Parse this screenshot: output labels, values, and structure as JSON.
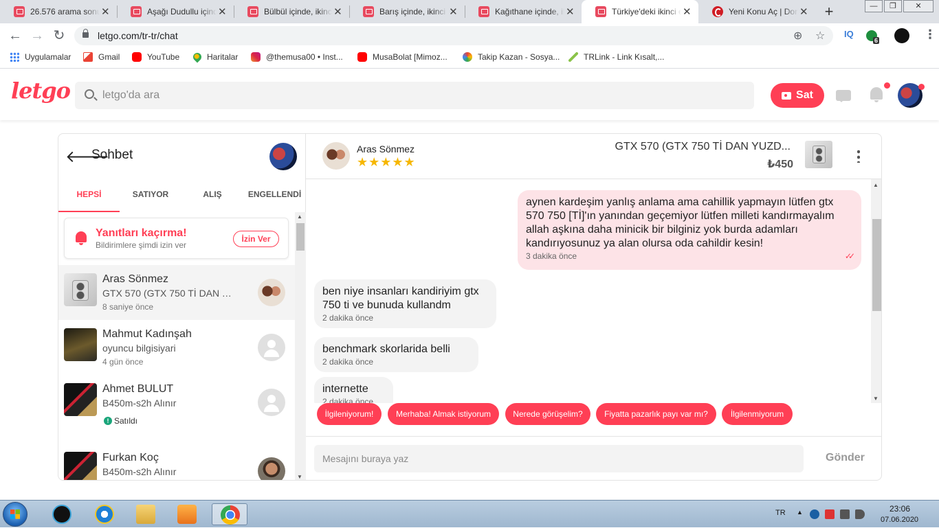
{
  "browser": {
    "tabs": [
      {
        "title": "26.576 arama sonuç",
        "active": false
      },
      {
        "title": "Aşağı Dudullu içind",
        "active": false
      },
      {
        "title": "Bülbül içinde, ikinci",
        "active": false
      },
      {
        "title": "Barış içinde, ikinci e",
        "active": false
      },
      {
        "title": "Kağıthane içinde, ik",
        "active": false
      },
      {
        "title": "Türkiye'deki ikinci e",
        "active": true
      },
      {
        "title": "Yeni Konu Aç | Don",
        "active": false
      }
    ],
    "url": "letgo.com/tr-tr/chat",
    "extensions": {
      "iq": "IQ",
      "badge_count": "6"
    },
    "bookmarks": [
      {
        "label": "Uygulamalar",
        "icon": "apps-grid-icon"
      },
      {
        "label": "Gmail",
        "icon": "gmail-icon"
      },
      {
        "label": "YouTube",
        "icon": "youtube-icon"
      },
      {
        "label": "Haritalar",
        "icon": "maps-icon"
      },
      {
        "label": "@themusa00 • Inst...",
        "icon": "instagram-icon"
      },
      {
        "label": "MusaBolat [Mimoz...",
        "icon": "youtube-icon"
      },
      {
        "label": "Takip Kazan - Sosya...",
        "icon": "takip-icon"
      },
      {
        "label": "TRLink - Link Kısalt,...",
        "icon": "trlink-icon"
      }
    ]
  },
  "header": {
    "logo": "letgo",
    "search_placeholder": "letgo'da ara",
    "sell_label": "Sat"
  },
  "chat": {
    "title": "Sohbet",
    "tabs": [
      "HEPSİ",
      "SATIYOR",
      "ALIŞ",
      "ENGELLENDİ"
    ],
    "active_tab": "HEPSİ",
    "notification": {
      "title": "Yanıtları kaçırma!",
      "subtitle": "Bildirimlere şimdi izin ver",
      "button": "İzin Ver"
    },
    "conversations": [
      {
        "name": "Aras Sönmez",
        "subtitle": "GTX 570 (GTX 750 Tİ DAN Y...",
        "time": "8 saniye önce",
        "selected": true
      },
      {
        "name": "Mahmut Kadınşah",
        "subtitle": "oyuncu bilgisiyari",
        "time": "4 gün önce",
        "selected": false
      },
      {
        "name": "Ahmet BULUT",
        "subtitle": "B450m-s2h Alınır",
        "status": "Satıldı",
        "selected": false
      },
      {
        "name": "Furkan Koç",
        "subtitle": "B450m-s2h Alınır",
        "selected": false
      }
    ],
    "active": {
      "user": "Aras Sönmez",
      "rating_stars": "★★★★★",
      "rating": 5,
      "product_title": "GTX 570 (GTX 750 Tİ DAN YUZD...",
      "price": "₺450"
    },
    "messages": [
      {
        "from": "me",
        "text": "aynen kardeşim yanlış anlama ama cahillik yapmayın lütfen gtx 570 750 [Tİ]'ın yanından geçemiyor lütfen milleti kandırmayalım allah aşkına daha minicik bir bilginiz yok burda adamları kandırıyosunuz ya alan olursa oda cahildir kesin!",
        "time": "3 dakika önce"
      },
      {
        "from": "them",
        "text": "ben niye insanları kandiriyim gtx 750 ti ve bunuda kullandm",
        "time": "2 dakika önce"
      },
      {
        "from": "them",
        "text": "benchmark skorlarida belli",
        "time": "2 dakika önce"
      },
      {
        "from": "them",
        "text": "internette",
        "time": "2 dakika önce"
      }
    ],
    "quick_replies": [
      "İlgileniyorum!",
      "Merhaba! Almak istiyorum",
      "Nerede görüşelim?",
      "Fiyatta pazarlık payı var mı?",
      "İlgilenmiyorum"
    ],
    "input_placeholder": "Mesajını buraya yaz",
    "send_label": "Gönder"
  },
  "taskbar": {
    "language": "TR",
    "time": "23:06",
    "date": "07.06.2020"
  },
  "colors": {
    "brand": "#ff3f55",
    "my_bubble": "#fde3e7",
    "their_bubble": "#f3f3f3",
    "star": "#f6b700"
  }
}
